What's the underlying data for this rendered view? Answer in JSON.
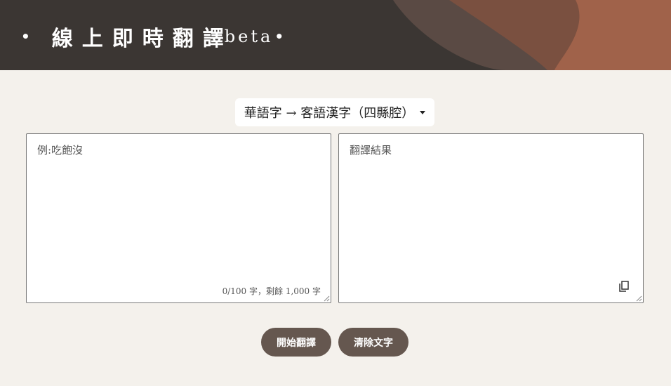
{
  "header": {
    "title": "線上即時翻譯",
    "beta": "beta",
    "bullet": "•"
  },
  "language_select": {
    "selected": "華語字 → 客語漢字（四縣腔）"
  },
  "input_panel": {
    "placeholder": "例:吃飽沒",
    "value": "",
    "counter": "0/100 字，剩餘 1,000 字"
  },
  "output_panel": {
    "placeholder": "翻譯結果"
  },
  "buttons": {
    "translate": "開始翻譯",
    "clear": "清除文字"
  },
  "icons": {
    "copy": "copy-icon",
    "dropdown": "caret-down-icon",
    "resize": "resize-grip-icon"
  },
  "colors": {
    "banner_bg": "#3b3633",
    "banner_accent": "#a0624a",
    "button_bg": "#65574f",
    "page_bg": "#f4f1ec"
  }
}
